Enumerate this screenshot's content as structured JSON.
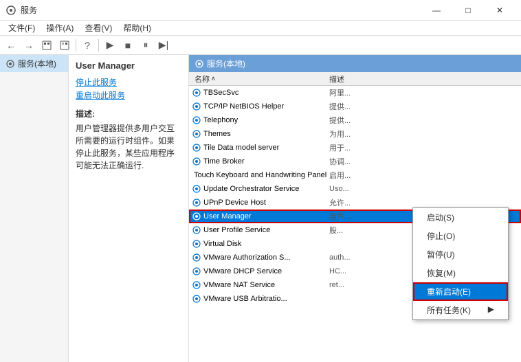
{
  "titleBar": {
    "icon": "⚙",
    "title": "服务",
    "minimizeLabel": "—",
    "restoreLabel": "□",
    "closeLabel": "✕"
  },
  "menuBar": {
    "items": [
      "文件(F)",
      "操作(A)",
      "查看(V)",
      "帮助(H)"
    ]
  },
  "toolbar": {
    "buttons": [
      "←",
      "→",
      "↑",
      "⚙",
      "?",
      "▶",
      "■",
      "⏸",
      "▶|"
    ]
  },
  "navPanel": {
    "items": [
      {
        "label": "服务(本地)",
        "selected": true
      }
    ]
  },
  "infoPanel": {
    "title": "User Manager",
    "stopLink": "停止此服务",
    "restartLink": "重启动此服务",
    "descTitle": "描述:",
    "descText": "用户管理器提供多用户交互所需要的运行时组件。如果停止此服务，某些应用程序可能无法正确运行."
  },
  "servicesHeader": {
    "icon": "⚙",
    "label": "服务(本地)"
  },
  "tableHeader": {
    "nameCol": "名称",
    "descCol": "描述",
    "sortArrow": "∧"
  },
  "services": [
    {
      "name": "TBSecSvc",
      "desc": "阿里...",
      "selected": false
    },
    {
      "name": "TCP/IP NetBIOS Helper",
      "desc": "提供...",
      "selected": false
    },
    {
      "name": "Telephony",
      "desc": "提供...",
      "selected": false
    },
    {
      "name": "Themes",
      "desc": "为用...",
      "selected": false
    },
    {
      "name": "Tile Data model server",
      "desc": "用于...",
      "selected": false
    },
    {
      "name": "Time Broker",
      "desc": "协调...",
      "selected": false
    },
    {
      "name": "Touch Keyboard and Handwriting Panel Servi...",
      "desc": "启用...",
      "selected": false
    },
    {
      "name": "Update Orchestrator Service",
      "desc": "Uso...",
      "selected": false
    },
    {
      "name": "UPnP Device Host",
      "desc": "允许...",
      "selected": false
    },
    {
      "name": "User Manager",
      "desc": "用户...",
      "selected": true
    },
    {
      "name": "User Profile Service",
      "desc": "股...",
      "selected": false
    },
    {
      "name": "Virtual Disk",
      "desc": "",
      "selected": false
    },
    {
      "name": "VMware Authorization S...",
      "desc": "auth...",
      "selected": false
    },
    {
      "name": "VMware DHCP Service",
      "desc": "HC...",
      "selected": false
    },
    {
      "name": "VMware NAT Service",
      "desc": "ret...",
      "selected": false
    },
    {
      "name": "VMware USB Arbitratio...",
      "desc": "",
      "selected": false
    }
  ],
  "contextMenu": {
    "items": [
      {
        "label": "启动(S)",
        "highlighted": false
      },
      {
        "label": "停止(O)",
        "highlighted": false
      },
      {
        "label": "暂停(U)",
        "highlighted": false
      },
      {
        "label": "恢复(M)",
        "highlighted": false
      },
      {
        "label": "重新启动(E)",
        "highlighted": true
      },
      {
        "label": "所有任务(K)",
        "highlighted": false,
        "hasArrow": true
      }
    ]
  }
}
